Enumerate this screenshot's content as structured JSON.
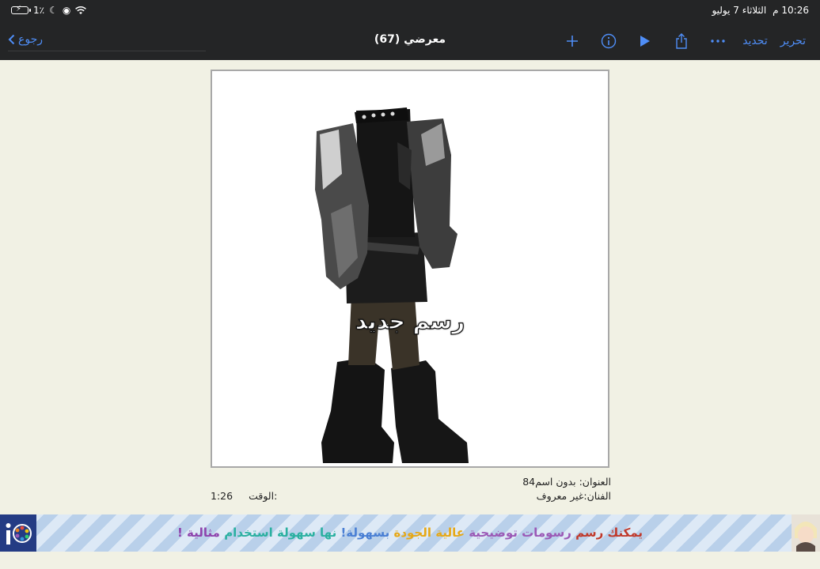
{
  "status_bar": {
    "time": "10:26 م",
    "date": "الثلاثاء 7 يوليو",
    "battery": "1٪"
  },
  "nav": {
    "back_label": "رجوع",
    "title": "معرضي (67)",
    "edit_label": "تحرير",
    "select_label": "تحديد",
    "icons": [
      "more-icon",
      "share-icon",
      "play-icon",
      "info-icon",
      "add-icon"
    ],
    "accent": "#4f8ef7"
  },
  "canvas": {
    "overlay_label": "رسم جديد"
  },
  "info": {
    "title_line": "العنوان: بدون اسم84",
    "artist_line": "الفنان:غير معروف",
    "time_label": "الوقت:",
    "time_value": "1:26"
  },
  "ad": {
    "parts": [
      {
        "text": "يمكنك رسم",
        "color": "#c0392b"
      },
      {
        "text": "رسومات توضيحية",
        "color": "#9b59b6"
      },
      {
        "text": "عالية الجودة",
        "color": "#e6a817"
      },
      {
        "text": "بسهولة!",
        "color": "#4a7fd4"
      },
      {
        "text": "نها سهولة استخدام",
        "color": "#2ab0a0"
      },
      {
        "text": "مثالية !",
        "color": "#8e44ad"
      }
    ]
  }
}
